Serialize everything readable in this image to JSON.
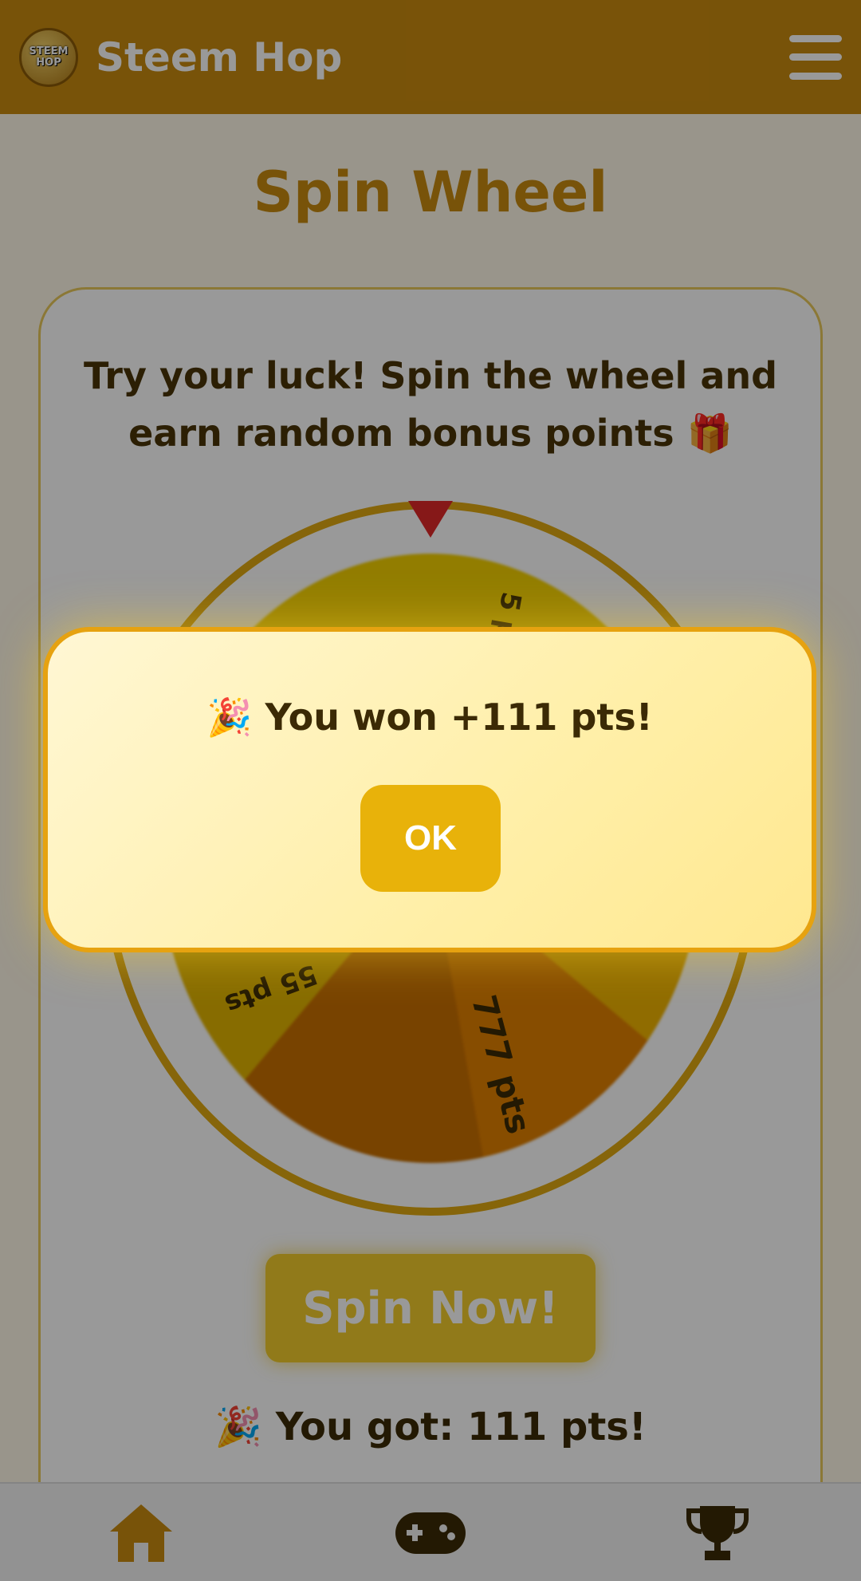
{
  "header": {
    "brand": "Steem Hop",
    "logo_text_1": "STEEM",
    "logo_text_2": "HOP",
    "menu_icon": "hamburger-menu-icon"
  },
  "title": "Spin Wheel",
  "subtitle": "Try your luck! Spin the wheel and earn random bonus points 🎁",
  "wheel": {
    "visible_labels": [
      "5 pts",
      "55 pts",
      "777 pts"
    ],
    "pointer_icon": "triangle-pointer-icon"
  },
  "spin_button": "Spin Now!",
  "result_text": "🎉 You got: 111 pts!",
  "modal": {
    "message": "🎉 You won +111 pts!",
    "ok_label": "OK"
  },
  "nav": {
    "items": [
      {
        "icon": "home-icon"
      },
      {
        "icon": "gamepad-icon"
      },
      {
        "icon": "trophy-icon"
      }
    ]
  },
  "colors": {
    "accent": "#c98a0f",
    "modal_border": "#e6a210",
    "ok_button": "#e8b20a",
    "pointer": "#e02828"
  }
}
